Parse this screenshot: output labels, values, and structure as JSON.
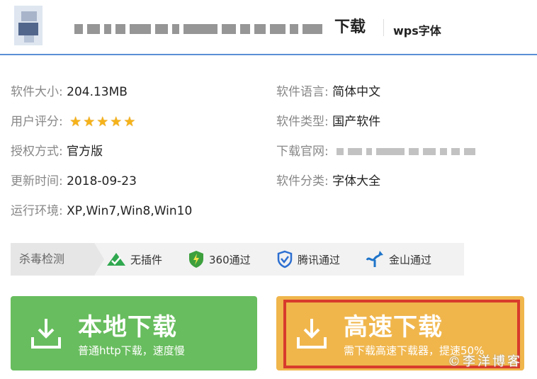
{
  "header": {
    "title_suffix": "下载",
    "tag": "wps字体"
  },
  "info": {
    "size": {
      "label": "软件大小:",
      "value": "204.13MB"
    },
    "rating": {
      "label": "用户评分:",
      "stars": 5
    },
    "license": {
      "label": "授权方式:",
      "value": "官方版"
    },
    "updated": {
      "label": "更新时间:",
      "value": "2018-09-23"
    },
    "env": {
      "label": "运行环境:",
      "value": "XP,Win7,Win8,Win10"
    },
    "language": {
      "label": "软件语言:",
      "value": "简体中文"
    },
    "type": {
      "label": "软件类型:",
      "value": "国产软件"
    },
    "website": {
      "label": "下载官网:"
    },
    "category": {
      "label": "软件分类:",
      "value": "字体大全"
    }
  },
  "security": {
    "label": "杀毒检测",
    "items": [
      {
        "icon": "no-plugin-icon",
        "label": "无插件"
      },
      {
        "icon": "360-shield-icon",
        "label": "360通过"
      },
      {
        "icon": "tencent-shield-icon",
        "label": "腾讯通过"
      },
      {
        "icon": "kingsoft-icon",
        "label": "金山通过"
      }
    ]
  },
  "buttons": {
    "local": {
      "title": "本地下载",
      "subtitle": "普通http下载，速度慢"
    },
    "fast": {
      "title": "高速下载",
      "subtitle": "需下载高速下载器，提速50%"
    }
  },
  "watermark": "©李洋博客",
  "colors": {
    "local_button": "#68bd5e",
    "fast_button": "#f0b64c",
    "highlight_frame": "#d83a2c",
    "header_rule": "#5b8fd6",
    "star": "#f5b21a"
  }
}
